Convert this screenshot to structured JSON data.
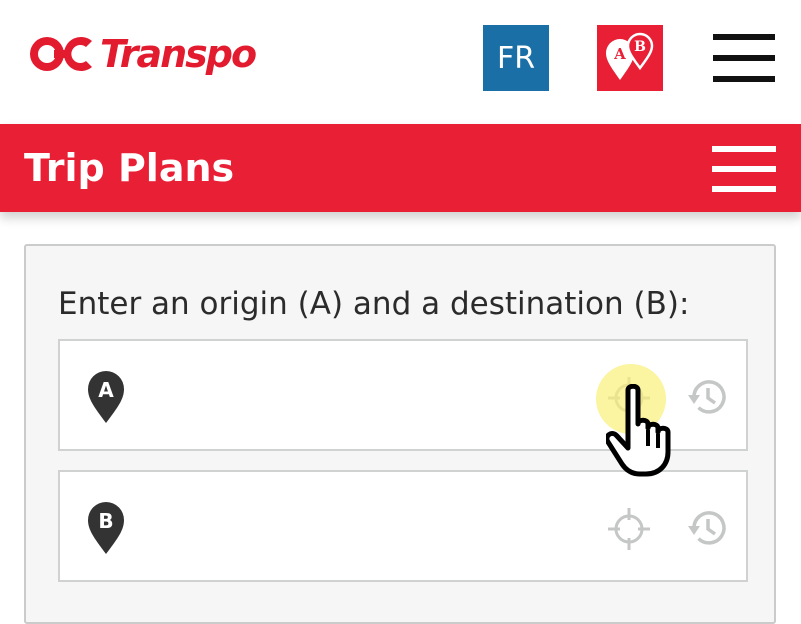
{
  "header": {
    "logo_text": "Transpo",
    "lang_button": "FR",
    "trip_planner_icon": "ab-pins-icon",
    "menu_icon": "hamburger-icon"
  },
  "title_bar": {
    "title": "Trip Plans",
    "menu_icon": "hamburger-icon"
  },
  "form": {
    "prompt": "Enter an origin (A) and a destination (B):",
    "origin": {
      "pin_letter": "A",
      "value": "",
      "placeholder": "",
      "locate_icon": "crosshair-icon",
      "history_icon": "history-icon"
    },
    "destination": {
      "pin_letter": "B",
      "value": "",
      "placeholder": "",
      "locate_icon": "crosshair-icon",
      "history_icon": "history-icon"
    }
  },
  "colors": {
    "brand_red": "#e81f35",
    "lang_blue": "#1a6fa6",
    "icon_gray": "#bfc3c1",
    "pin_dark": "#333333",
    "highlight": "#faf078"
  }
}
